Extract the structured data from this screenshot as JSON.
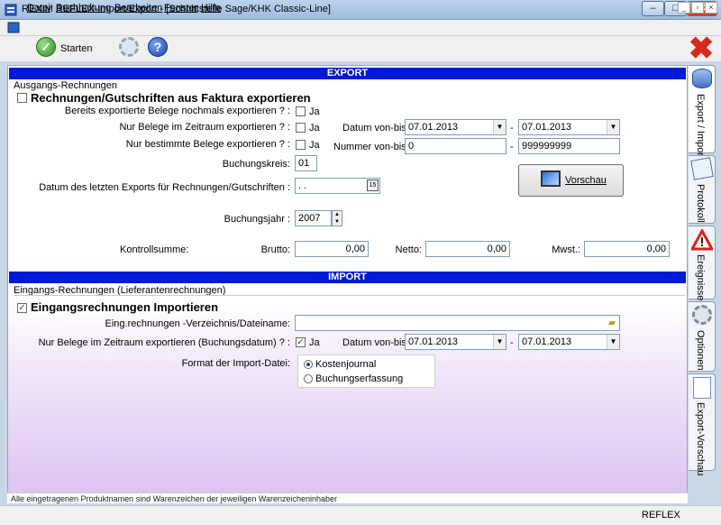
{
  "window": {
    "title": "REXIM REFLEX-Import/Export - [Schnittstelle Sage/KHK Classic-Line]",
    "min_glyph": "–",
    "max_glyph": "□",
    "close_glyph": "✕"
  },
  "menu": {
    "items": [
      "Datei",
      "Buchhaltung",
      "Bearbeiten",
      "Fenster",
      "Hilfe"
    ],
    "mdi_min": "_",
    "mdi_restore": "▫",
    "mdi_close": "×"
  },
  "toolbar": {
    "start_label": "Starten",
    "start_glyph": "✓",
    "help_glyph": "?",
    "close_glyph": "✖"
  },
  "export": {
    "header": "EXPORT",
    "group_label": "Ausgangs-Rechnungen",
    "main_check_label": "Rechnungen/Gutschriften aus Faktura exportieren",
    "rows": {
      "already_label": "Bereits exportierte Belege nochmals exportieren ? :",
      "period_label": "Nur Belege im Zeitraum exportieren ? :",
      "specific_label": "Nur bestimmte Belege exportieren ? :",
      "ja": "Ja"
    },
    "date_range_label": "Datum von-bis:",
    "date_from": "07.01.2013",
    "date_to": "07.01.2013",
    "number_range_label": "Nummer von-bis:",
    "number_from": "0",
    "number_to": "999999999",
    "dash": "-",
    "buchungskreis_label": "Buchungskreis:",
    "buchungskreis_value": "01",
    "last_export_label": "Datum des letzten Exports für Rechnungen/Gutschriften :",
    "last_export_value": " . .",
    "preview_button": "Vorschau",
    "buchungsjahr_label": "Buchungsjahr :",
    "buchungsjahr_value": "2007",
    "kontrollsumme_label": "Kontrollsumme:",
    "brutto_label": "Brutto:",
    "brutto_value": "0,00",
    "netto_label": "Netto:",
    "netto_value": "0,00",
    "mwst_label": "Mwst.:",
    "mwst_value": "0,00"
  },
  "import": {
    "header": "IMPORT",
    "group_label": "Eingangs-Rechnungen (Lieferantenrechnungen)",
    "main_check_label": "Eingangsrechnungen Importieren",
    "dir_label": "Eing.rechnungen -Verzeichnis/Dateiname:",
    "dir_value": "",
    "period_label": "Nur Belege im Zeitraum exportieren (Buchungsdatum) ? :",
    "ja": "Ja",
    "date_range_label": "Datum von-bis:",
    "date_from": "07.01.2013",
    "date_to": "07.01.2013",
    "dash": "-",
    "format_label": "Format der Import-Datei:",
    "format_options": [
      "Kostenjournal",
      "Buchungserfassung"
    ],
    "format_selected": "Kostenjournal"
  },
  "side_tabs": [
    {
      "label": "Export / Import",
      "icon": "database-arrow-icon"
    },
    {
      "label": "Protokoll",
      "icon": "notebook-icon"
    },
    {
      "label": "Ereignisse",
      "icon": "warning-triangle-icon"
    },
    {
      "label": "Optionen",
      "icon": "gear-icon"
    },
    {
      "label": "Export-Vorschau",
      "icon": "document-icon"
    }
  ],
  "footer_note": "Alle eingetragenen Produktnamen sind Warenzeichen der jeweiligen Warenzeicheninhaber",
  "status": "REFLEX"
}
